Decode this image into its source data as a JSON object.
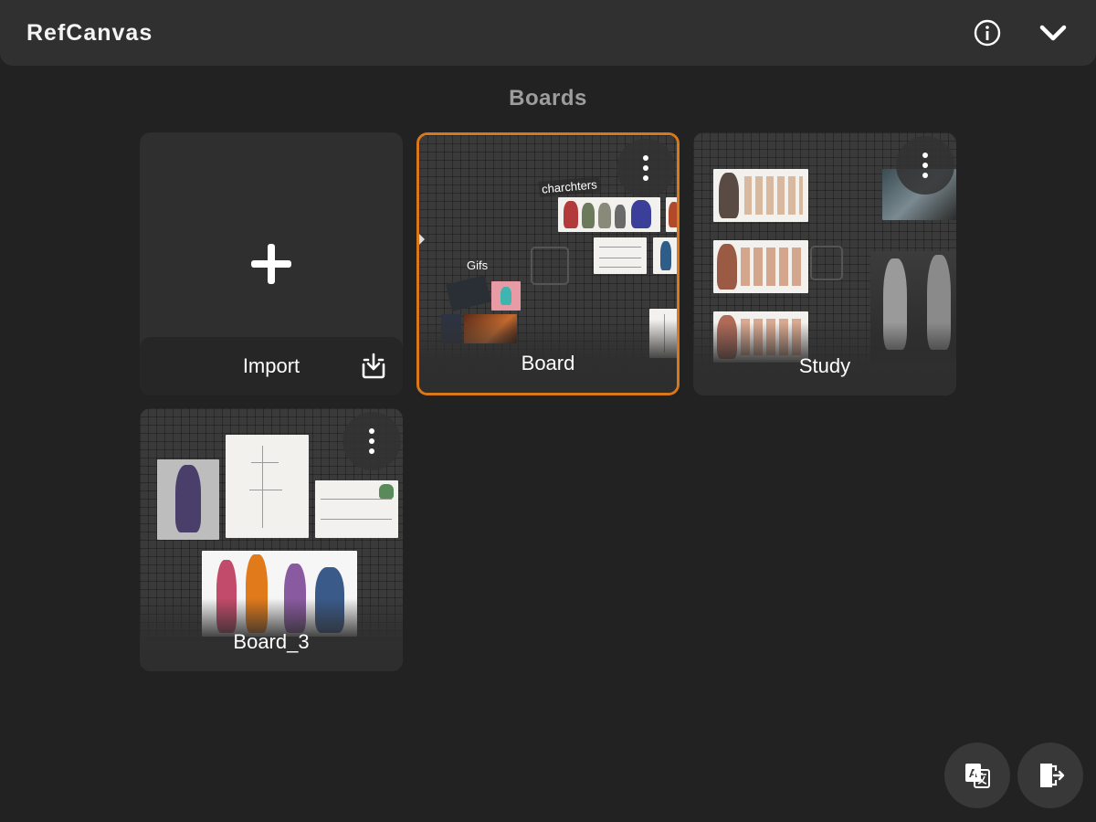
{
  "app": {
    "title": "RefCanvas"
  },
  "header": {
    "info_icon": "info-circle-icon",
    "collapse_icon": "chevron-down-icon"
  },
  "section": {
    "title": "Boards"
  },
  "import_card": {
    "label": "Import",
    "icon": "plus-icon",
    "action_icon": "download-tray-icon"
  },
  "boards": [
    {
      "name": "Board",
      "selected": true,
      "tags": [
        "charchters",
        "Gifs"
      ]
    },
    {
      "name": "Study",
      "selected": false
    },
    {
      "name": "Board_3",
      "selected": false
    }
  ],
  "footer_actions": [
    {
      "name": "translate",
      "icon": "translate-icon"
    },
    {
      "name": "exit",
      "icon": "exit-door-icon"
    }
  ],
  "colors": {
    "background": "#222222",
    "topbar": "#303030",
    "selected_border": "#d9781a",
    "section_title": "#9d9d9d"
  }
}
